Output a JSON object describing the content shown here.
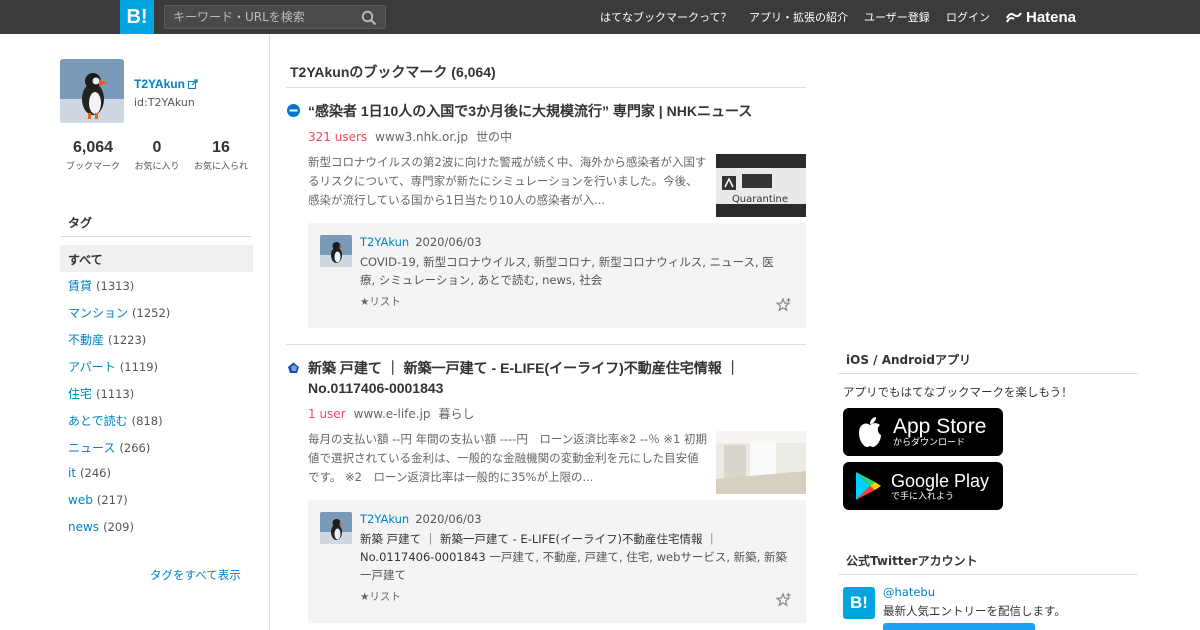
{
  "topbar": {
    "logo": "B!",
    "search_placeholder": "キーワード・URLを検索",
    "nav": [
      "はてなブックマークって？",
      "アプリ・拡張の紹介",
      "ユーザー登録",
      "ログイン"
    ],
    "brand": "Hatena"
  },
  "profile": {
    "name": "T2YAkun",
    "id": "id:T2YAkun",
    "stats": [
      {
        "value": "6,064",
        "label": "ブックマーク"
      },
      {
        "value": "0",
        "label": "お気に入り"
      },
      {
        "value": "16",
        "label": "お気に入られ"
      }
    ]
  },
  "tags": {
    "heading": "タグ",
    "all": "すべて",
    "items": [
      {
        "name": "賃貸",
        "count": "(1313)"
      },
      {
        "name": "マンション",
        "count": "(1252)"
      },
      {
        "name": "不動産",
        "count": "(1223)"
      },
      {
        "name": "アパート",
        "count": "(1119)"
      },
      {
        "name": "住宅",
        "count": "(1113)"
      },
      {
        "name": "あとで読む",
        "count": "(818)"
      },
      {
        "name": "ニュース",
        "count": "(266)"
      },
      {
        "name": "it",
        "count": "(246)"
      },
      {
        "name": "web",
        "count": "(217)"
      },
      {
        "name": "news",
        "count": "(209)"
      }
    ],
    "show_all": "タグをすべて表示"
  },
  "main": {
    "title": "T2YAkunのブックマーク (6,064)",
    "entries": [
      {
        "title": "“感染者 1日10人の入国で3か月後に大規模流行” 専門家 | NHKニュース",
        "users": "321 users",
        "domain": "www3.nhk.or.jp",
        "category": "世の中",
        "description": "新型コロナウイルスの第2波に向けた警戒が続く中、海外から感染者が入国するリスクについて、専門家が新たにシミュレーションを行いました。今後、感染が流行している国から1日当たり10人の感染者が入...",
        "thumb_text": "Quarantine",
        "bookmark": {
          "user": "T2YAkun",
          "date": "2020/06/03",
          "comment": "",
          "tags": "COVID-19, 新型コロナウイルス, 新型コロナ, 新型コロナウィルス, ニュース, 医療, シミュレーション, あとで読む, news, 社会",
          "list_label": "★リスト"
        }
      },
      {
        "title": "新築 戸建て ｜ 新築一戸建て - E-LIFE(イーライフ)不動産住宅情報 ｜ No.0117406-0001843",
        "users": "1 user",
        "domain": "www.e-life.jp",
        "category": "暮らし",
        "description": "毎月の支払い額 --円 年間の支払い額 ----円　ローン返済比率※2 --％ ※1 初期値で選択されている金利は、一般的な金融機関の変動金利を元にした目安値です。 ※2　ローン返済比率は一般的に35%が上限の...",
        "thumb_text": "",
        "bookmark": {
          "user": "T2YAkun",
          "date": "2020/06/03",
          "comment": "新築 戸建て ｜ 新築一戸建て - E-LIFE(イーライフ)不動産住宅情報 ｜ No.0117406-0001843",
          "tags": "一戸建て, 不動産, 戸建て, 住宅, webサービス, 新築, 新築一戸建て",
          "list_label": "★リスト"
        }
      }
    ]
  },
  "right": {
    "apps_heading": "iOS / Androidアプリ",
    "apps_text": "アプリでもはてなブックマークを楽しもう！",
    "appstore_small": "からダウンロード",
    "appstore_big": "App Store",
    "googleplay_big": "Google Play",
    "googleplay_small": "で手に入れよう",
    "twitter_heading": "公式Twitterアカウント",
    "twitter_logo": "B!",
    "twitter_handle": "@hatebu",
    "twitter_desc": "最新人気エントリーを配信します。"
  },
  "colors": {
    "accent": "#00a4de",
    "link": "#0083c4",
    "users": "#ff4166",
    "topbar": "#3b3b3b"
  }
}
